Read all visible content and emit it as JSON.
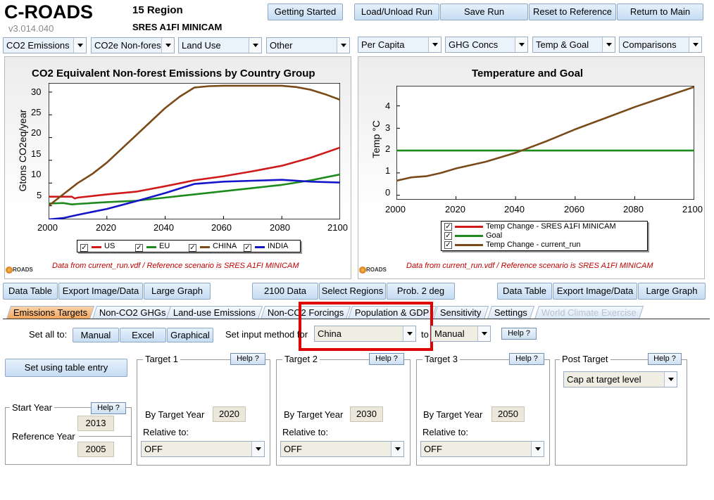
{
  "app": {
    "title": "C-ROADS",
    "version": "v3.014.040",
    "region": "15 Region",
    "scenario": "SRES A1FI MINICAM"
  },
  "top_buttons": {
    "getting_started": "Getting Started",
    "load_unload": "Load/Unload Run",
    "save_run": "Save Run",
    "reset": "Reset to Reference",
    "return_main": "Return to Main"
  },
  "left_dropdowns": [
    "CO2 Emissions",
    "CO2e Non-forest",
    "Land Use",
    "Other"
  ],
  "right_dropdowns": [
    "Per Capita",
    "GHG Concs",
    "Temp & Goal",
    "Comparisons"
  ],
  "left_chart": {
    "title": "CO2 Equivalent Non-forest Emissions by Country Group",
    "ylabel": "Gtons CO2eq/year",
    "x_ticks": [
      "2000",
      "2020",
      "2040",
      "2060",
      "2080",
      "2100"
    ],
    "y_ticks": [
      "5",
      "10",
      "15",
      "20",
      "25",
      "30"
    ],
    "legend": [
      "US",
      "EU",
      "CHINA",
      "INDIA"
    ],
    "note": "Data from current_run.vdf / Reference scenario is SRES A1FI MINICAM",
    "logo": "ROADS"
  },
  "right_chart": {
    "title": "Temperature and Goal",
    "ylabel": "Temp °C",
    "x_ticks": [
      "2000",
      "2020",
      "2040",
      "2060",
      "2080",
      "2100"
    ],
    "y_ticks": [
      "0",
      "1",
      "2",
      "3",
      "4"
    ],
    "legend": [
      "Temp Change - SRES A1FI MINICAM",
      "Goal",
      "Temp Change - current_run"
    ],
    "note": "Data from current_run.vdf / Reference scenario is SRES A1FI MINICAM",
    "logo": "ROADS"
  },
  "chart_data": [
    {
      "type": "line",
      "title": "CO2 Equivalent Non-forest Emissions by Country Group",
      "xlabel": "",
      "ylabel": "Gtons CO2eq/year",
      "xlim": [
        2000,
        2100
      ],
      "ylim": [
        2,
        32
      ],
      "series": [
        {
          "name": "US",
          "color": "#d01a1a",
          "x": [
            2000,
            2002,
            2008,
            2009,
            2010,
            2020,
            2030,
            2040,
            2050,
            2060,
            2070,
            2080,
            2090,
            2100
          ],
          "y": [
            7.0,
            7.0,
            7.0,
            6.6,
            6.8,
            7.5,
            8.1,
            9.3,
            10.6,
            11.5,
            12.6,
            13.8,
            15.6,
            17.8
          ]
        },
        {
          "name": "EU",
          "color": "#1d8a1d",
          "x": [
            2000,
            2005,
            2008,
            2010,
            2020,
            2030,
            2040,
            2050,
            2060,
            2070,
            2080,
            2090,
            2100
          ],
          "y": [
            5.5,
            5.6,
            5.3,
            5.4,
            5.8,
            6.1,
            6.8,
            7.5,
            8.2,
            8.9,
            9.6,
            10.6,
            11.9
          ]
        },
        {
          "name": "CHINA",
          "color": "#7a4a18",
          "x": [
            2000,
            2005,
            2010,
            2015,
            2020,
            2025,
            2030,
            2035,
            2040,
            2045,
            2050,
            2055,
            2060,
            2070,
            2080,
            2085,
            2090,
            2095,
            2100
          ],
          "y": [
            5.0,
            7.5,
            10.0,
            12.0,
            14.5,
            17.5,
            20.5,
            23.5,
            26.5,
            29.0,
            31.0,
            31.3,
            31.4,
            31.4,
            31.4,
            31.1,
            30.5,
            29.5,
            28.3
          ]
        },
        {
          "name": "INDIA",
          "color": "#1515c8",
          "x": [
            2000,
            2005,
            2010,
            2020,
            2030,
            2040,
            2045,
            2050,
            2060,
            2070,
            2080,
            2090,
            2100
          ],
          "y": [
            2.0,
            2.3,
            3.0,
            4.3,
            6.0,
            7.8,
            8.8,
            9.8,
            10.3,
            10.5,
            10.7,
            10.3,
            10.1
          ]
        }
      ]
    },
    {
      "type": "line",
      "title": "Temperature and Goal",
      "xlabel": "",
      "ylabel": "Temp °C",
      "xlim": [
        2000,
        2100
      ],
      "ylim": [
        -0.2,
        4.9
      ],
      "series": [
        {
          "name": "Goal",
          "color": "#1d8a1d",
          "x": [
            2000,
            2100
          ],
          "y": [
            2.0,
            2.0
          ]
        },
        {
          "name": "Temp Change - current_run",
          "color": "#7a4a18",
          "x": [
            2000,
            2005,
            2010,
            2015,
            2020,
            2030,
            2040,
            2050,
            2060,
            2070,
            2080,
            2090,
            2100
          ],
          "y": [
            0.65,
            0.8,
            0.85,
            1.0,
            1.2,
            1.5,
            1.9,
            2.4,
            2.95,
            3.45,
            3.95,
            4.4,
            4.85
          ]
        }
      ]
    }
  ],
  "below_chart_buttons": {
    "data_table_left": "Data Table",
    "export_left": "Export Image/Data",
    "large_graph_left": "Large Graph",
    "data_2100": "2100 Data",
    "select_regions": "Select Regions",
    "prob_2deg": "Prob. 2 deg",
    "data_table_right": "Data Table",
    "export_right": "Export Image/Data",
    "large_graph_right": "Large Graph"
  },
  "tabs": [
    "Emissions Targets",
    "Non-CO2 GHGs",
    "Land-use Emissions",
    "Non-CO2 Forcings",
    "Population & GDP",
    "Sensitivity",
    "Settings",
    "World Climate Exercise"
  ],
  "controls": {
    "set_all_to": "Set all to:",
    "manual": "Manual",
    "excel": "Excel",
    "graphical": "Graphical",
    "set_input_method_for": "Set input method for",
    "region_value": "China",
    "to": "to",
    "method_value": "Manual",
    "help": "Help ?",
    "set_using_table": "Set using table entry"
  },
  "start_box": {
    "start_year_label": "Start Year",
    "start_year": "2013",
    "reference_year_label": "Reference Year",
    "reference_year": "2005"
  },
  "targets": [
    {
      "label": "Target 1",
      "by_label": "By Target Year",
      "year": "2020",
      "relative_label": "Relative to:",
      "relative_value": "OFF"
    },
    {
      "label": "Target 2",
      "by_label": "By Target Year",
      "year": "2030",
      "relative_label": "Relative to:",
      "relative_value": "OFF"
    },
    {
      "label": "Target 3",
      "by_label": "By Target Year",
      "year": "2050",
      "relative_label": "Relative to:",
      "relative_value": "OFF"
    }
  ],
  "post_target": {
    "label": "Post Target",
    "value": "Cap at target level"
  }
}
